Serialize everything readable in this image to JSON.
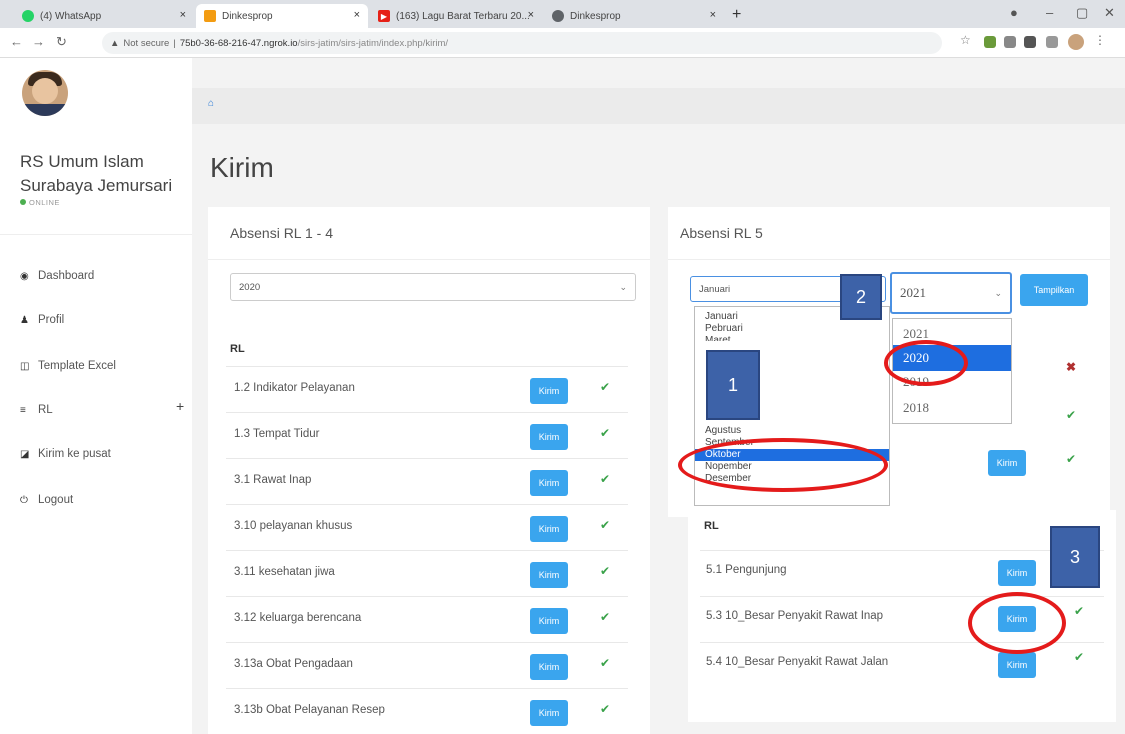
{
  "browser": {
    "tabs": [
      {
        "title": "(4) WhatsApp",
        "color": "#25d366"
      },
      {
        "title": "Dinkesprop",
        "color": "#f39c12"
      },
      {
        "title": "(163) Lagu Barat Terbaru 20...",
        "color": "#e62117"
      },
      {
        "title": "Dinkesprop",
        "color": "#5f6368"
      }
    ],
    "new_tab": "+",
    "url_warning": "Not secure",
    "url_host": "75b0-36-68-216-47.ngrok.io",
    "url_path": "/sirs-jatim/sirs-jatim/index.php/kirim/"
  },
  "sidebar": {
    "hospital_name": "RS Umum Islam Surabaya Jemursari",
    "status": "ONLINE",
    "menu": [
      {
        "label": "Dashboard",
        "icon": "dashboard-icon"
      },
      {
        "label": "Profil",
        "icon": "user-icon"
      },
      {
        "label": "Template Excel",
        "icon": "template-icon"
      },
      {
        "label": "RL",
        "icon": "list-icon"
      },
      {
        "label": "Kirim ke pusat",
        "icon": "send-icon"
      },
      {
        "label": "Logout",
        "icon": "power-icon"
      }
    ]
  },
  "main": {
    "page_title": "Kirim",
    "panel_left": {
      "title": "Absensi RL 1 - 4",
      "year_select": "2020",
      "rl_header": "RL",
      "rows": [
        {
          "label": "1.2 Indikator Pelayanan",
          "button": "Kirim",
          "status": "done"
        },
        {
          "label": "1.3 Tempat Tidur",
          "button": "Kirim",
          "status": "done"
        },
        {
          "label": "3.1 Rawat Inap",
          "button": "Kirim",
          "status": "done"
        },
        {
          "label": "3.10 pelayanan khusus",
          "button": "Kirim",
          "status": "done"
        },
        {
          "label": "3.11 kesehatan jiwa",
          "button": "Kirim",
          "status": "done"
        },
        {
          "label": "3.12 keluarga berencana",
          "button": "Kirim",
          "status": "done"
        },
        {
          "label": "3.13a Obat Pengadaan",
          "button": "Kirim",
          "status": "done"
        },
        {
          "label": "3.13b Obat Pelayanan Resep",
          "button": "Kirim",
          "status": "done"
        }
      ]
    },
    "panel_right": {
      "title": "Absensi RL 5",
      "month_select": "Januari",
      "year_select": "2021",
      "show_button": "Tampilkan",
      "rl_header": "RL",
      "rows": [
        {
          "label": "5.1 Pengunjung",
          "button": "Kirim",
          "status": "none"
        },
        {
          "label": "5.3 10_Besar Penyakit Rawat Inap",
          "button": "Kirim",
          "status": "done"
        },
        {
          "label": "5.4 10_Besar Penyakit Rawat Jalan",
          "button": "Kirim",
          "status": "done"
        }
      ],
      "partial_buttons": [
        "Kirim"
      ]
    },
    "month_options": [
      "Januari",
      "Pebruari",
      "Maret",
      "Agustus",
      "September",
      "Oktober",
      "Nopember",
      "Desember"
    ],
    "month_selected": "Oktober",
    "year_options": [
      "2021",
      "2020",
      "2019",
      "2018"
    ],
    "year_selected": "2020"
  },
  "annotations": {
    "callout_1": "1",
    "callout_2": "2",
    "callout_3": "3",
    "color": "#e41b1b",
    "box_color": "#3d62a8"
  }
}
